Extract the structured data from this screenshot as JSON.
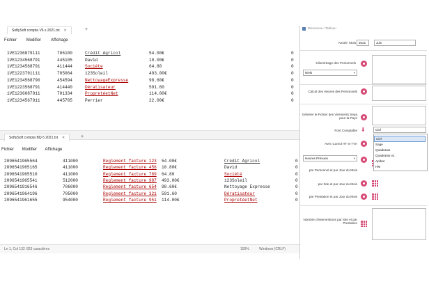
{
  "window1": {
    "tab_title": "SoftySoft compta V6 s 2021.txt",
    "menu": [
      "Fichier",
      "Modifier",
      "Affichage"
    ],
    "lines": [
      {
        "account": "1VE1236879111",
        "code": "706100",
        "name": "Crédit Agricol",
        "amount": "54.00€",
        "zero": "0",
        "mark": "partial"
      },
      {
        "account": "1VE1234568791",
        "code": "445105",
        "name": "David",
        "amount": "10.00€",
        "zero": "0",
        "mark": "none"
      },
      {
        "account": "1VE1234568791",
        "code": "411444",
        "name": "Sociéte",
        "amount": "64.80",
        "zero": "0",
        "mark": "red"
      },
      {
        "account": "1VE1223791111",
        "code": "705064",
        "name": "123Soleil",
        "amount": "493.00€",
        "zero": "0",
        "mark": "none"
      },
      {
        "account": "1VE1234568790",
        "code": "454594",
        "name": "NettoyageExpresse",
        "amount": "98.60€",
        "zero": "0",
        "mark": "red"
      },
      {
        "account": "1VE1223568791",
        "code": "414440",
        "name": "Dératisateur",
        "amount": "591.60",
        "zero": "0",
        "mark": "red"
      },
      {
        "account": "1VE1236087911",
        "code": "701334",
        "name": "PropretéetNet",
        "amount": "114.00€",
        "zero": "0",
        "mark": "red"
      },
      {
        "account": "1VE1234567911",
        "code": "445705",
        "name": "Perrier",
        "amount": "22.00€",
        "zero": "0",
        "mark": "none"
      }
    ]
  },
  "window2": {
    "tab_title": "SoftySoft compta BQ 6 2021.txt",
    "menu": [
      "Fichier",
      "Modifier",
      "Affichage"
    ],
    "lines": [
      {
        "id": "2096541965564",
        "code": "411000",
        "lib": "Reglement facture 123",
        "amount": "54.00€",
        "name": "Crédit Agricol",
        "mark": "partial",
        "zero": "0"
      },
      {
        "id": "2096541965165",
        "code": "411000",
        "lib": "Reglement facture 456",
        "amount": "10.80€",
        "name": "David",
        "mark": "none",
        "zero": "0"
      },
      {
        "id": "2096541965510",
        "code": "411000",
        "lib": "Reglement facture 789",
        "amount": "64.80",
        "name": "Société",
        "mark": "red",
        "zero": "0"
      },
      {
        "id": "2096541965541",
        "code": "512000",
        "lib": "Reglement facture 987",
        "amount": "493.00€",
        "name": "123Soleil",
        "mark": "none",
        "zero": "0"
      },
      {
        "id": "2096541916546",
        "code": "706000",
        "lib": "Reglement facture 654",
        "amount": "98.60€",
        "name": "Nettoyage Expresse",
        "mark": "none",
        "zero": "0"
      },
      {
        "id": "2096541964196",
        "code": "705000",
        "lib": "Reglement facture 321",
        "amount": "591.60",
        "name": "Dératisateur",
        "mark": "red",
        "zero": "0"
      },
      {
        "id": "2096541961655",
        "code": "954000",
        "lib": "Reglement facture 951",
        "amount": "114.00€",
        "name": "PropretéetNet",
        "mark": "red",
        "zero": "0"
      }
    ],
    "status": {
      "position": "Ln 1, Col 132",
      "chars": "823 caractères",
      "zoom": "100%",
      "eol": "Windows (CRLF)"
    }
  },
  "panel": {
    "header": "Bienvenue / Tableau",
    "year_label": "Année",
    "year": "2021",
    "month_label": "Mois",
    "month": "Juin",
    "km_label": "Kilométrage des Personnels",
    "person_select": "Niels",
    "hours_label": "Calcul des Heures des Personnels",
    "virement_label": "Générer le Fichier des Virements Sepa pour la Paye",
    "font_label": "Font Comptable",
    "font_selected": "Ciel",
    "font_options": [
      "Ciel",
      "Sage",
      "Quadratus",
      "Quadratus v1",
      "Apibat",
      "HM"
    ],
    "ht_label": "Avec Cumul HT et TVA",
    "hours_select": "Heures Prévues",
    "per_person_label": "par Personnel et par Jour du Mois",
    "per_site_label": "par Site et par Jour du Mois",
    "per_presta_label": "par Prestation et par Jour du Mois",
    "interventions_label": "Nombre d'Interventions par Site et par Prestation"
  }
}
